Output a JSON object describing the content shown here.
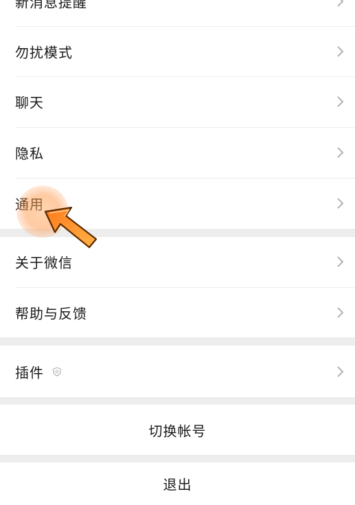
{
  "settings": {
    "items": [
      {
        "label": "新消息提醒"
      },
      {
        "label": "勿扰模式"
      },
      {
        "label": "聊天"
      },
      {
        "label": "隐私"
      },
      {
        "label": "通用"
      },
      {
        "label": "关于微信"
      },
      {
        "label": "帮助与反馈"
      },
      {
        "label": "插件"
      }
    ],
    "switch_account": "切换帐号",
    "logout": "退出"
  },
  "icons": {
    "chevron": "chevron-right-icon",
    "plugin_badge": "shield-icon",
    "pointer": "arrow-pointer-icon"
  },
  "colors": {
    "background": "#ffffff",
    "section_gap": "#ededed",
    "divider": "#ececec",
    "text": "#1a1a1a",
    "chevron": "#b2b2b2",
    "highlight": "#ff8a2a"
  }
}
